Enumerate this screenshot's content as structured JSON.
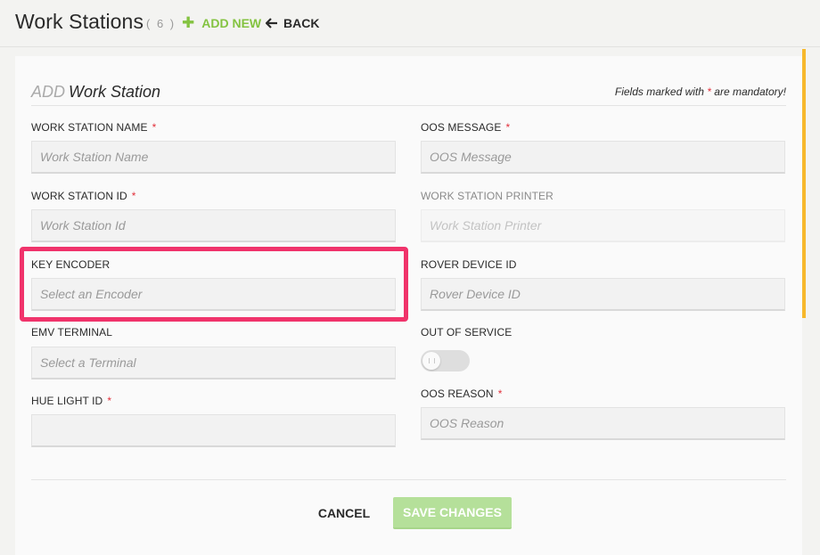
{
  "header": {
    "title": "Work Stations",
    "count": "( 6 )",
    "add_new_label": "ADD NEW",
    "back_label": "BACK"
  },
  "form": {
    "heading_prefix": "ADD",
    "heading_main": "Work Station",
    "mandatory_prefix": "Fields marked with",
    "mandatory_star": "*",
    "mandatory_suffix": "are mandatory!",
    "required_marker": "*",
    "fields": {
      "work_station_name": {
        "label": "WORK STATION NAME",
        "placeholder": "Work Station Name",
        "value": "",
        "required": true
      },
      "oos_message": {
        "label": "OOS MESSAGE",
        "placeholder": "OOS Message",
        "value": "",
        "required": true
      },
      "work_station_id": {
        "label": "WORK STATION ID",
        "placeholder": "Work Station Id",
        "value": "",
        "required": true
      },
      "work_station_printer": {
        "label": "WORK STATION PRINTER",
        "placeholder": "Work Station Printer",
        "value": "",
        "required": false,
        "disabled": true
      },
      "key_encoder": {
        "label": "KEY ENCODER",
        "placeholder": "Select an Encoder",
        "required": false
      },
      "rover_device_id": {
        "label": "ROVER DEVICE ID",
        "placeholder": "Rover Device ID",
        "value": "",
        "required": false
      },
      "emv_terminal": {
        "label": "EMV TERMINAL",
        "placeholder": "Select a Terminal",
        "required": false
      },
      "out_of_service": {
        "label": "OUT OF SERVICE",
        "enabled": false
      },
      "hue_light_id": {
        "label": "HUE LIGHT ID",
        "placeholder": "",
        "value": "",
        "required": true
      },
      "oos_reason": {
        "label": "OOS REASON",
        "placeholder": "OOS Reason",
        "value": "",
        "required": true
      }
    }
  },
  "actions": {
    "cancel_label": "CANCEL",
    "save_label": "SAVE CHANGES"
  },
  "colors": {
    "accent_green": "#84c341",
    "save_button_disabled": "#b5e09a",
    "required_star": "#e2303b",
    "highlight": "#f0336b",
    "scroll_accent": "#f7b82c"
  }
}
